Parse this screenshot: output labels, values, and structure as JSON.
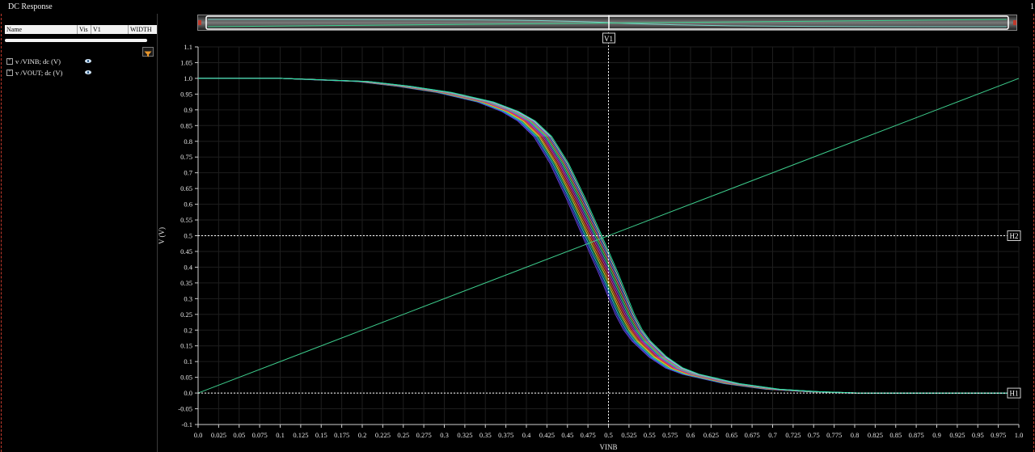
{
  "window": {
    "title": "DC Response",
    "corner": "1"
  },
  "browser": {
    "columns": [
      "Name",
      "Vis",
      "V1",
      "WIDTH"
    ],
    "signals": [
      {
        "label": "v /VINB; dc (V)",
        "expander": "+"
      },
      {
        "label": "v /VOUT; dc (V)",
        "expander": "+"
      }
    ]
  },
  "markers": {
    "v1": "V1",
    "h1": "H1",
    "h2": "H2"
  },
  "colors": {
    "vinb_trace": "#3ecf8e",
    "sweep_traces": [
      "#6a3dd6",
      "#3050d8",
      "#2db7d9",
      "#26b26a",
      "#d8d23a",
      "#e08a2a",
      "#d23b3b",
      "#c83aa8",
      "#8e3ed0",
      "#29c7b0",
      "#6fd14e",
      "#e85a8a",
      "#4a8cf0",
      "#c8c8c8",
      "#1fe0a0"
    ]
  },
  "chart_data": {
    "type": "line",
    "xlabel": "VINB",
    "ylabel": "V (V)",
    "xlim": [
      0.0,
      1.0
    ],
    "ylim": [
      -0.1,
      1.1
    ],
    "x_ticks": [
      "0.0",
      "0.025",
      "0.05",
      "0.075",
      "0.1",
      "0.125",
      "0.15",
      "0.175",
      "0.2",
      "0.225",
      "0.25",
      "0.275",
      "0.3",
      "0.325",
      "0.35",
      "0.375",
      "0.4",
      "0.425",
      "0.45",
      "0.475",
      "0.5",
      "0.525",
      "0.55",
      "0.575",
      "0.6",
      "0.625",
      "0.65",
      "0.675",
      "0.7",
      "0.725",
      "0.75",
      "0.775",
      "0.8",
      "0.825",
      "0.85",
      "0.875",
      "0.9",
      "0.925",
      "0.95",
      "0.975",
      "1.0"
    ],
    "y_ticks": [
      "-0.1",
      "-0.05",
      "0.0",
      "0.05",
      "0.1",
      "0.15",
      "0.2",
      "0.25",
      "0.3",
      "0.35",
      "0.4",
      "0.45",
      "0.5",
      "0.55",
      "0.6",
      "0.65",
      "0.7",
      "0.75",
      "0.8",
      "0.85",
      "0.9",
      "0.95",
      "1.0",
      "1.05",
      "1.1"
    ],
    "vertical_marker_x": 0.5,
    "horizontal_markers_y": {
      "H1": 0.0,
      "H2": 0.5
    },
    "vinb": {
      "x": [
        0.0,
        1.0
      ],
      "y": [
        0.0,
        1.0
      ]
    },
    "vout_sweep": {
      "count": 15,
      "switch_threshold_min": 0.478,
      "switch_threshold_max": 0.502,
      "x": [
        0.0,
        0.1,
        0.2,
        0.25,
        0.3,
        0.35,
        0.38,
        0.4,
        0.42,
        0.44,
        0.46,
        0.47,
        0.48,
        0.49,
        0.5,
        0.51,
        0.52,
        0.53,
        0.54,
        0.56,
        0.58,
        0.6,
        0.65,
        0.7,
        0.75,
        0.8,
        0.85,
        1.0
      ],
      "y_nominal": [
        1.0,
        1.0,
        0.99,
        0.975,
        0.955,
        0.925,
        0.895,
        0.865,
        0.815,
        0.73,
        0.62,
        0.56,
        0.5,
        0.44,
        0.38,
        0.315,
        0.25,
        0.2,
        0.165,
        0.115,
        0.08,
        0.06,
        0.03,
        0.012,
        0.004,
        0.0,
        0.0,
        0.0
      ]
    }
  }
}
